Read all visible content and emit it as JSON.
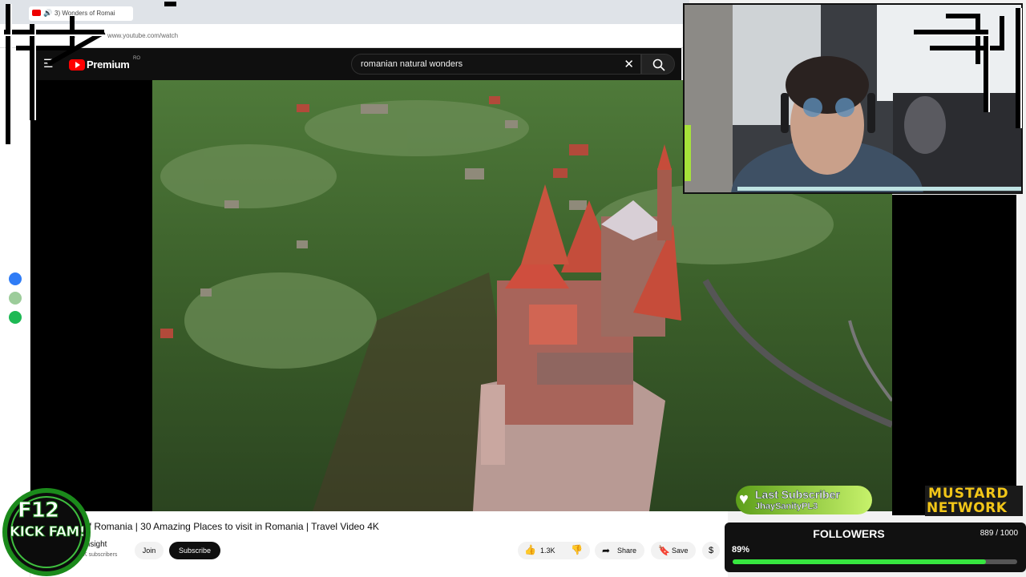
{
  "browser": {
    "tab_title": "3) Wonders of Romai",
    "url": "www.youtube.com/watch",
    "new_tab_icon": "plus-icon"
  },
  "youtube": {
    "logo_text": "Premium",
    "logo_country": "RO",
    "search_query": "romanian natural wonders",
    "video_title": "of Romania | 30 Amazing Places to visit in Romania | Travel Video 4K",
    "channel_name": "Insight",
    "subscriber_text": "K subscribers",
    "join_label": "Join",
    "subscribe_label": "Subscribe",
    "like_count": "1.3K",
    "share_label": "Share",
    "save_label": "Save"
  },
  "overlay": {
    "badge_line1": "F12",
    "badge_line2": "KICK FAM!",
    "last_subscriber_label": "Last Subscriber",
    "last_subscriber_name": "JhaySanityPL3",
    "network_line1": "MUSTARD",
    "network_line2": "NETWORK",
    "followers_label": "FOLLOWERS",
    "followers_count": "889 / 1000",
    "followers_percent": "89%",
    "followers_progress": 0.889
  },
  "colors": {
    "yt_red": "#ff0000",
    "progress_green": "#37e640",
    "badge_green": "#1b8a1b",
    "mustard": "#f2c618"
  }
}
